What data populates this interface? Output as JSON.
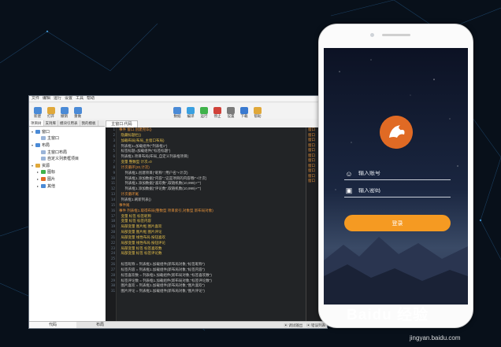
{
  "ide": {
    "menu": [
      "文件",
      "编辑",
      "运行",
      "设置",
      "工具",
      "帮助"
    ],
    "toolbar": [
      {
        "label": "新建",
        "icon": "new-file-icon",
        "color": "#4a8ad6"
      },
      {
        "label": "打开",
        "icon": "folder-open-icon",
        "color": "#e0a83a"
      },
      {
        "label": "撤销",
        "icon": "undo-icon",
        "color": "#4a8ad6"
      },
      {
        "label": "重做",
        "icon": "redo-icon",
        "color": "#4a8ad6"
      }
    ],
    "toolbar2": [
      {
        "label": "数据",
        "icon": "database-icon",
        "color": "#4a8ad6"
      },
      {
        "label": "编译",
        "icon": "compile-icon",
        "color": "#3aa0e0"
      },
      {
        "label": "运行",
        "icon": "run-icon",
        "color": "#3fb24a"
      },
      {
        "label": "停止",
        "icon": "stop-icon",
        "color": "#d0423a"
      },
      {
        "label": "设置",
        "icon": "settings-icon",
        "color": "#7a7a7a"
      },
      {
        "label": "下载",
        "icon": "download-icon",
        "color": "#3a7ad0"
      },
      {
        "label": "帮助",
        "icon": "help-icon",
        "color": "#e0a83a"
      }
    ],
    "left_tabs": [
      "项目树",
      "支持库",
      "模块引用表",
      "我的模板"
    ],
    "tree": [
      {
        "level": 0,
        "label": "窗口",
        "color": "#4a8ad6",
        "exp": "▾"
      },
      {
        "level": 1,
        "label": "主窗口",
        "color": "#9ab4d8",
        "exp": ""
      },
      {
        "level": 0,
        "label": "布局",
        "color": "#4a8ad6",
        "exp": "▾"
      },
      {
        "level": 1,
        "label": "主窗口布局",
        "color": "#9ab4d8",
        "exp": ""
      },
      {
        "level": 1,
        "label": "自定义列表框项目",
        "color": "#9ab4d8",
        "exp": ""
      },
      {
        "level": 0,
        "label": "资源",
        "color": "#e0a83a",
        "exp": "▾"
      },
      {
        "level": 1,
        "label": "图标",
        "color": "#3fb24a",
        "exp": "▸"
      },
      {
        "level": 1,
        "label": "图片",
        "color": "#e06a24",
        "exp": "▸"
      },
      {
        "level": 1,
        "label": "其他",
        "color": "#4a8ad6",
        "exp": "▸"
      }
    ],
    "editor_tab": "主窗口.代码",
    "bottom_tabs": [
      "代码",
      "布局"
    ],
    "status": [
      "调试输出",
      "错误列表"
    ],
    "right_pane": [
      "窗口",
      "窗口",
      "窗口",
      "窗口",
      "窗口",
      "窗口",
      "窗口",
      "窗口",
      "窗口",
      "窗口",
      "窗口"
    ],
    "code": [
      {
        "t": "事件 窗口.创建完毕()",
        "c": "c-orange"
      },
      {
        "t": "  隐藏标题栏()",
        "c": "c-yellow"
      },
      {
        "t": "  加载布局(布局_主窗口布局)",
        "c": "c-yellow"
      },
      {
        "t": "  列表框1=加载组件(\"列表框1\")",
        "c": ""
      },
      {
        "t": "  标签标题=加载组件(\"标签标题\")",
        "c": ""
      },
      {
        "t": "  列表框1.项目布局(布局_自定义列表框项目)",
        "c": ""
      },
      {
        "t": "  变量 整数型 计次=0",
        "c": "c-yellow"
      },
      {
        "t": "  计次循环(20,计次)",
        "c": "c-orange"
      },
      {
        "t": "      列表框1.创建项目(\"昵称\",\"用户名\"+计次)",
        "c": ""
      },
      {
        "t": "      列表框1.添加数据(\"内容\",\"这是项目的内容哦!\"+计次)",
        "c": ""
      },
      {
        "t": "      列表框1.添加数据(\"喜欢数\",取随机数(10,999)+\"\")",
        "c": ""
      },
      {
        "t": "      列表框1.添加数据(\"评论数\",取随机数(10,999)+\"\")",
        "c": ""
      },
      {
        "t": "  计次循环尾",
        "c": "c-orange"
      },
      {
        "t": "  列表框1.刷新列表()",
        "c": ""
      },
      {
        "t": "事件尾",
        "c": "c-orange"
      },
      {
        "t": "事件 列表框1.取得布局(整数型 项目索引,对象型 新布局对象)",
        "c": "c-orange"
      },
      {
        "t": "  变量 标签 标签昵称",
        "c": "c-yellow"
      },
      {
        "t": "  变量 标签 标签内容",
        "c": "c-yellow"
      },
      {
        "t": "  局部变量 图片框 图片喜欢",
        "c": "c-yellow"
      },
      {
        "t": "  局部变量 图片框 图片评论",
        "c": "c-yellow"
      },
      {
        "t": "  局部变量 线性布局 按钮喜欢",
        "c": "c-yellow"
      },
      {
        "t": "  局部变量 线性布局 按钮评论",
        "c": "c-yellow"
      },
      {
        "t": "  局部变量 标签 标签喜欢数",
        "c": "c-yellow"
      },
      {
        "t": "  局部变量 标签 标签评论数",
        "c": "c-yellow"
      },
      {
        "t": "",
        "c": ""
      },
      {
        "t": "  标签昵称 = 列表框1.加载组件(新布局对象,\"标签昵称\")",
        "c": ""
      },
      {
        "t": "  标签内容 = 列表框1.加载组件(新布局对象,\"标签内容\")",
        "c": ""
      },
      {
        "t": "  标签喜欢数 = 列表框1.加载组件(新布局对象,\"标签喜欢数\")",
        "c": ""
      },
      {
        "t": "  标签评论数 = 列表框1.加载组件(新布局对象,\"标签评论数\")",
        "c": ""
      },
      {
        "t": "  图片喜欢 = 列表框1.加载组件(新布局对象,\"图片喜欢\")",
        "c": ""
      },
      {
        "t": "  图片评论 = 列表框1.加载组件(新布局对象,\"图片评论\")",
        "c": ""
      }
    ]
  },
  "phone": {
    "account_placeholder": "输入账号",
    "password_placeholder": "输入密码",
    "login_label": "登录",
    "accent": "#f59a22",
    "logo_color": "#e06a24"
  },
  "watermark": {
    "text": "Baidu 经验",
    "site": "jingyan.baidu.com"
  }
}
